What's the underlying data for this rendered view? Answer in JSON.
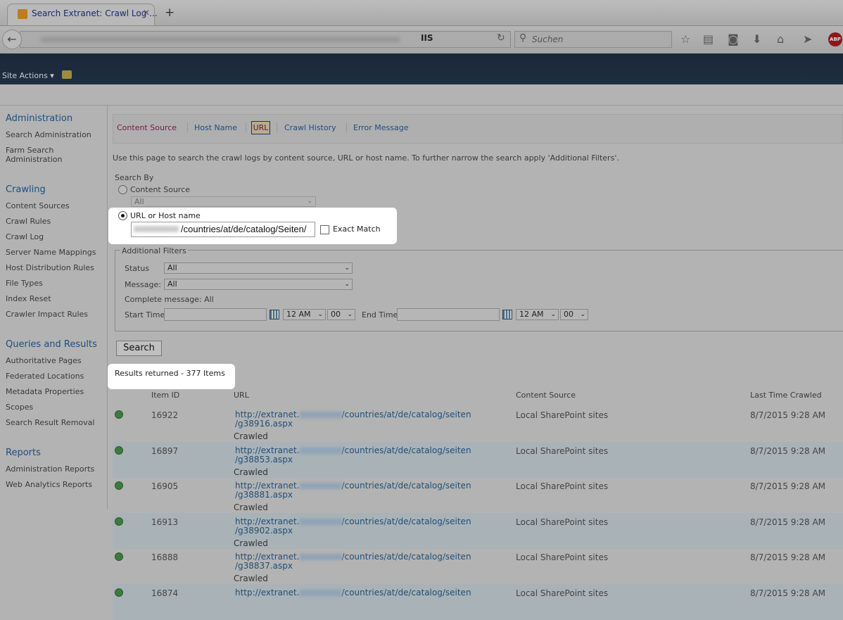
{
  "browser": {
    "tab_title": "Search Extranet: Crawl Log ...",
    "search_placeholder": "Suchen",
    "url_icons": "IIS",
    "abp": "ABP"
  },
  "ribbon": {
    "site_actions": "Site Actions ▾"
  },
  "sidebar": {
    "sections": [
      {
        "heading": "Administration",
        "items": [
          "Search Administration",
          "Farm Search Administration"
        ]
      },
      {
        "heading": "Crawling",
        "items": [
          "Content Sources",
          "Crawl Rules",
          "Crawl Log",
          "Server Name Mappings",
          "Host Distribution Rules",
          "File Types",
          "Index Reset",
          "Crawler Impact Rules"
        ]
      },
      {
        "heading": "Queries and Results",
        "items": [
          "Authoritative Pages",
          "Federated Locations",
          "Metadata Properties",
          "Scopes",
          "Search Result Removal"
        ]
      },
      {
        "heading": "Reports",
        "items": [
          "Administration Reports",
          "Web Analytics Reports"
        ]
      }
    ]
  },
  "tabs": [
    "Content Source",
    "Host Name",
    "URL",
    "Crawl History",
    "Error Message"
  ],
  "active_tab": "URL",
  "intro": "Use this page to search the crawl logs by content source, URL or host name. To further narrow the search apply 'Additional Filters'.",
  "search_by": {
    "label": "Search By",
    "content_source": "Content Source",
    "content_source_value": "All",
    "url_option": "URL or Host name",
    "url_value": "/countries/at/de/catalog/Seiten/",
    "exact_match": "Exact Match"
  },
  "filters": {
    "legend": "Additional Filters",
    "status_label": "Status",
    "status_value": "All",
    "message_label": "Message:",
    "message_value": "All",
    "complete_message": "Complete message: All",
    "start_time": "Start Time",
    "end_time": "End Time",
    "hour": "12 AM",
    "minute": "00"
  },
  "search_button": "Search",
  "results": "Results returned - 377 Items",
  "columns": [
    "Item ID",
    "URL",
    "Content Source",
    "Last Time Crawled"
  ],
  "rows": [
    {
      "id": "16922",
      "url_a": "http://extranet.",
      "url_b": "/countries/at/de/catalog/seiten",
      "url_c": "/g38916.aspx",
      "status": "Crawled",
      "source": "Local SharePoint sites",
      "time": "8/7/2015 9:28 AM"
    },
    {
      "id": "16897",
      "url_a": "http://extranet.",
      "url_b": "/countries/at/de/catalog/seiten",
      "url_c": "/g38853.aspx",
      "status": "Crawled",
      "source": "Local SharePoint sites",
      "time": "8/7/2015 9:28 AM"
    },
    {
      "id": "16905",
      "url_a": "http://extranet.",
      "url_b": "/countries/at/de/catalog/seiten",
      "url_c": "/g38881.aspx",
      "status": "Crawled",
      "source": "Local SharePoint sites",
      "time": "8/7/2015 9:28 AM"
    },
    {
      "id": "16913",
      "url_a": "http://extranet.",
      "url_b": "/countries/at/de/catalog/seiten",
      "url_c": "/g38902.aspx",
      "status": "Crawled",
      "source": "Local SharePoint sites",
      "time": "8/7/2015 9:28 AM"
    },
    {
      "id": "16888",
      "url_a": "http://extranet.",
      "url_b": "/countries/at/de/catalog/seiten",
      "url_c": "/g38837.aspx",
      "status": "Crawled",
      "source": "Local SharePoint sites",
      "time": "8/7/2015 9:28 AM"
    },
    {
      "id": "16874",
      "url_a": "http://extranet.",
      "url_b": "/countries/at/de/catalog/seiten",
      "url_c": "",
      "status": "",
      "source": "Local SharePoint sites",
      "time": "8/7/2015 9:28 AM"
    }
  ]
}
